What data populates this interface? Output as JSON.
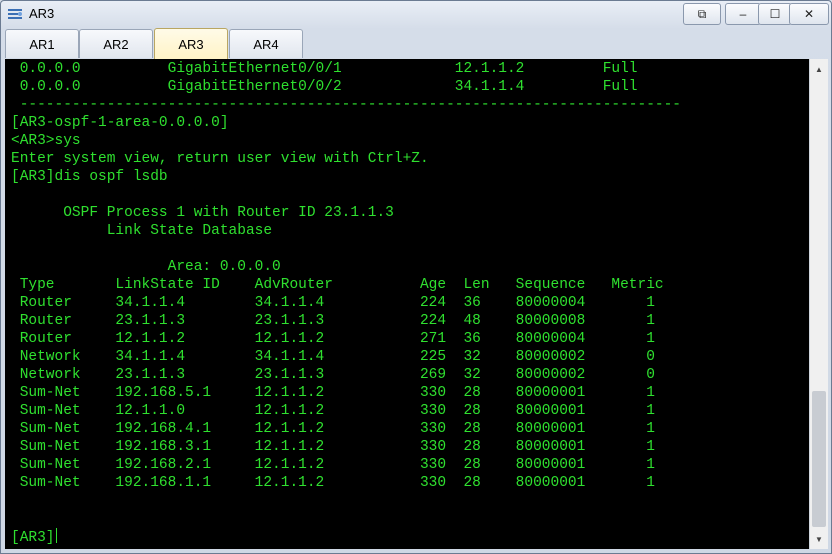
{
  "window": {
    "title": "AR3",
    "controls": {
      "restore_window": "⧉",
      "minimize": "–",
      "maximize": "☐",
      "close": "✕"
    }
  },
  "tabs": [
    {
      "label": "AR1",
      "active": false
    },
    {
      "label": "AR2",
      "active": false
    },
    {
      "label": "AR3",
      "active": true
    },
    {
      "label": "AR4",
      "active": false
    }
  ],
  "terminal": {
    "lines": [
      " 0.0.0.0          GigabitEthernet0/0/1             12.1.1.2         Full",
      " 0.0.0.0          GigabitEthernet0/0/2             34.1.1.4         Full",
      " ----------------------------------------------------------------------------",
      "[AR3-ospf-1-area-0.0.0.0]",
      "<AR3>sys",
      "Enter system view, return user view with Ctrl+Z.",
      "[AR3]dis ospf lsdb",
      "",
      "      OSPF Process 1 with Router ID 23.1.1.3",
      "           Link State Database",
      "",
      "                  Area: 0.0.0.0",
      " Type       LinkState ID    AdvRouter          Age  Len   Sequence   Metric",
      " Router     34.1.1.4        34.1.1.4           224  36    80000004       1",
      " Router     23.1.1.3        23.1.1.3           224  48    80000008       1",
      " Router     12.1.1.2        12.1.1.2           271  36    80000004       1",
      " Network    34.1.1.4        34.1.1.4           225  32    80000002       0",
      " Network    23.1.1.3        23.1.1.3           269  32    80000002       0",
      " Sum-Net    192.168.5.1     12.1.1.2           330  28    80000001       1",
      " Sum-Net    12.1.1.0        12.1.1.2           330  28    80000001       1",
      " Sum-Net    192.168.4.1     12.1.1.2           330  28    80000001       1",
      " Sum-Net    192.168.3.1     12.1.1.2           330  28    80000001       1",
      " Sum-Net    192.168.2.1     12.1.1.2           330  28    80000001       1",
      " Sum-Net    192.168.1.1     12.1.1.2           330  28    80000001       1",
      "",
      ""
    ],
    "prompt": "[AR3]"
  },
  "colors": {
    "terminal_bg": "#000000",
    "terminal_text": "#2fe02f",
    "active_tab": "#fff3c6"
  },
  "icons": [
    "app-icon",
    "scroll-up-icon",
    "scroll-down-icon"
  ]
}
